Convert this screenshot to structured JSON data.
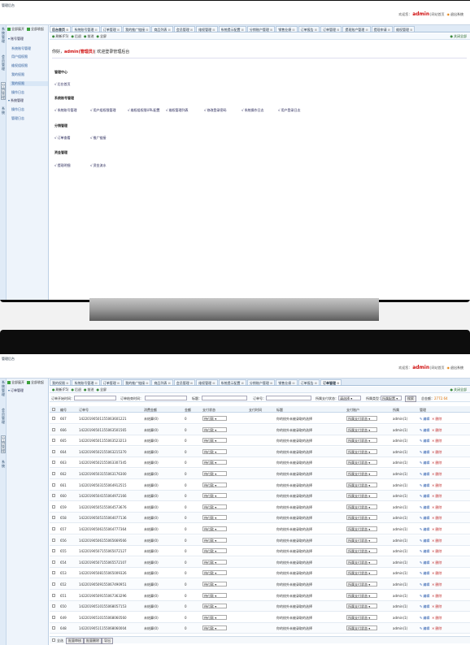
{
  "frame1": {
    "title": "管理后台",
    "header": {
      "greeting": "欢迎您：",
      "user": "admin",
      "sep": "|",
      "site_home": "网站首页",
      "logout": "退出系统"
    },
    "vtabs": [
      "系统管理",
      "会员管理",
      "分销管理",
      "系统"
    ],
    "nav_top": [
      "全部展开",
      "全部收起"
    ],
    "nav_groups": [
      {
        "label": "账号管理",
        "items": [
          "系统账号管理",
          "用户组权限",
          "维权组权限",
          "我的权限"
        ]
      },
      {
        "label": "系统管理",
        "items": [
          "操作日志",
          "管理日志"
        ]
      }
    ],
    "nav_selected": "我的权限",
    "nav_other": [
      "操作日志",
      "管理日志"
    ],
    "tabs": [
      "后台首页",
      "系统账号管理",
      "订单管理",
      "我的推广链接",
      "商品列表",
      "会员管理",
      "维权管理",
      "系统提示配置",
      "分销账户管理",
      "销售业绩",
      "订单报告",
      "订单管理",
      "提现账户管理",
      "提现申请",
      "维权管理"
    ],
    "subbar": [
      "刷新(F5)",
      "后退",
      "前进",
      "全屏"
    ],
    "close_all": "关闭全部",
    "welcome_pre": "你好，",
    "welcome_user": "admin(管理员)",
    "welcome_post": "|  欢迎登录管理后台",
    "sections": [
      {
        "title": "管理中心",
        "links": [
          "后台首页"
        ]
      },
      {
        "title": "系统账号管理",
        "links": [
          "系统账号管理",
          "用户组权限管理",
          "维权组权限URL配置",
          "维权管理列表",
          "修改登录密码",
          "系统操作日志",
          "用户登录日志"
        ]
      },
      {
        "title": "分销管理",
        "links": [
          "订单查看",
          "推广链接"
        ]
      },
      {
        "title": "资金管理",
        "links": [
          "提现明细",
          "资金流水"
        ]
      }
    ]
  },
  "frame2": {
    "title": "管理后台",
    "header": {
      "greeting": "欢迎您：",
      "user": "admin",
      "sep": "|",
      "site_home": "网站首页",
      "logout": "退出系统"
    },
    "vtabs": [
      "系统管理",
      "会员管理",
      "分销管理",
      "系统"
    ],
    "nav_top": [
      "全部展开",
      "全部收起"
    ],
    "nav_groups": [
      {
        "label": "订单管理",
        "items": []
      }
    ],
    "tabs": [
      "我的权限",
      "系统账号管理",
      "订单管理",
      "我的推广链接",
      "商品列表",
      "会员管理",
      "维权管理",
      "系统提示配置",
      "分销账户管理",
      "销售业绩",
      "订单报告",
      "订单管理"
    ],
    "subbar": [
      "刷新(F5)",
      "后退",
      "前进",
      "全屏"
    ],
    "close_all": "关闭全部",
    "filter": {
      "start_label": "订单开始时间：",
      "end_label": "订单结束时间：",
      "title_label": "标题：",
      "order_label": "订单号：",
      "pay_label": "所属支付状态：",
      "pay_value": "请选择",
      "type_label": "所属类型：",
      "type_value": "所属配置",
      "search": "搜索",
      "total_label": "总金额：",
      "total_value": "2772.64"
    },
    "columns": [
      "编号",
      "订单号",
      "消费金额",
      "金额",
      "支付状态",
      "支付时间",
      "标题",
      "支付账户",
      "所属",
      "管理"
    ],
    "rows": [
      {
        "id": "667",
        "order": "14220190501155063601221"
      },
      {
        "id": "666",
        "order": "14220190501155063501565"
      },
      {
        "id": "665",
        "order": "14220190501155063523213"
      },
      {
        "id": "664",
        "order": "14220190502155063215370"
      },
      {
        "id": "663",
        "order": "14220190502155063307345"
      },
      {
        "id": "662",
        "order": "14220190503155063176300"
      },
      {
        "id": "661",
        "order": "14220190503155064912515"
      },
      {
        "id": "660",
        "order": "14220190504155064972166"
      },
      {
        "id": "659",
        "order": "14220190505155064573676"
      },
      {
        "id": "658",
        "order": "14220190505155064077136"
      },
      {
        "id": "657",
        "order": "14220190506155064777364"
      },
      {
        "id": "656",
        "order": "14220190506155065669566"
      },
      {
        "id": "655",
        "order": "14220190507155065072127"
      },
      {
        "id": "654",
        "order": "14220190507155065572107"
      },
      {
        "id": "653",
        "order": "14220190508155065009326"
      },
      {
        "id": "652",
        "order": "14220190509155067490951"
      },
      {
        "id": "651",
        "order": "14220190509155067363296"
      },
      {
        "id": "650",
        "order": "14220190510155068057153"
      },
      {
        "id": "649",
        "order": "14220190510155068060560"
      },
      {
        "id": "648",
        "order": "14220190511155068060004"
      }
    ],
    "row_common": {
      "amount": "未结算(0)",
      "money": "0",
      "status": "待付款",
      "title": "你的校外未被录取的选择",
      "account": "所属支付状态",
      "owner": "admin(1)",
      "edit": "编辑",
      "del": "删除"
    },
    "footer": [
      "全选",
      "批量审核",
      "批量删除",
      "导出"
    ]
  }
}
